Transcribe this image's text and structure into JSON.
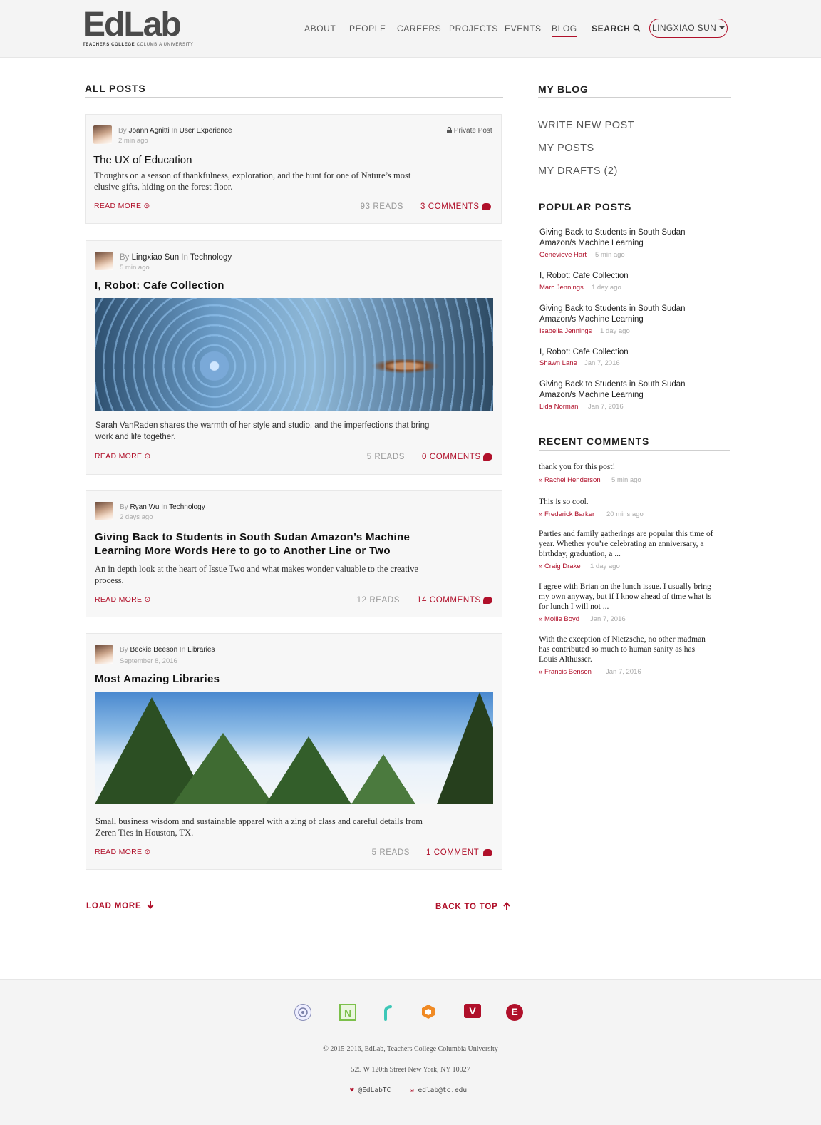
{
  "header": {
    "logo_text": "EdLab",
    "logo_sub_bold": "TEACHERS COLLEGE",
    "logo_sub": "COLUMBIA UNIVERSITY",
    "nav": [
      "ABOUT",
      "PEOPLE",
      "CAREERS",
      "PROJECTS",
      "EVENTS",
      "BLOG"
    ],
    "search_label": "SEARCH",
    "user_label": "LINGXIAO SUN"
  },
  "main": {
    "title": "ALL POSTS",
    "posts": [
      {
        "by": "By",
        "author": "Joann Agnitti",
        "in": "In",
        "category": "User Experience",
        "time": "2 min ago",
        "private": "Private Post",
        "title": "The UX of Education",
        "excerpt": "Thoughts on a season of thankfulness, exploration, and the hunt for one of Nature’s most elusive gifts, hiding on the forest floor.",
        "read_more": "READ MORE",
        "reads": "93 READS",
        "comments": "3 COMMENTS"
      },
      {
        "by": "By",
        "author": "Lingxiao Sun",
        "in": "In",
        "category": "Technology",
        "time": "5 min ago",
        "title": "I, Robot: Cafe Collection",
        "excerpt": "Sarah VanRaden shares the warmth of her style and studio, and the imperfections that bring work and life together.",
        "read_more": "READ MORE",
        "reads": "5 READS",
        "comments": "0 COMMENTS"
      },
      {
        "by": "By",
        "author": "Ryan Wu",
        "in": "In",
        "category": "Technology",
        "time": "2 days ago",
        "title": "Giving Back to Students in South Sudan Amazon’s Machine Learning More Words Here to go to Another Line or Two",
        "excerpt": "An in depth look at the heart of Issue Two and what makes wonder valuable to the creative process.",
        "read_more": "READ MORE",
        "reads": "12 READS",
        "comments": "14 COMMENTS"
      },
      {
        "by": "By",
        "author": "Beckie Beeson",
        "in": "In",
        "category": "Libraries",
        "time": "September 8, 2016",
        "title": "Most Amazing Libraries",
        "excerpt": "Small business wisdom and sustainable apparel with a zing of class and careful details from Zeren Ties in Houston, TX.",
        "read_more": "READ MORE",
        "reads": "5 READS",
        "comments": "1 COMMENT"
      }
    ],
    "load_more": "LOAD MORE",
    "back_to_top": "BACK TO TOP"
  },
  "sidebar": {
    "my_blog_title": "MY BLOG",
    "links": [
      "WRITE NEW POST",
      "MY POSTS",
      "MY DRAFTS (2)"
    ],
    "popular_title": "POPULAR POSTS",
    "popular": [
      {
        "title": "Giving Back to Students in South Sudan Amazon/s Machine Learning",
        "author": "Genevieve Hart",
        "time": "5 min ago"
      },
      {
        "title": "I, Robot: Cafe Collection",
        "author": "Marc Jennings",
        "time": "1 day ago"
      },
      {
        "title": "Giving Back to Students in South Sudan Amazon/s Machine Learning",
        "author": "Isabella Jennings",
        "time": "1 day ago"
      },
      {
        "title": "I, Robot: Cafe Collection",
        "author": "Shawn Lane",
        "time": "Jan 7, 2016"
      },
      {
        "title": "Giving Back to Students in South Sudan Amazon/s Machine Learning",
        "author": "Lida Norman",
        "time": "Jan 7, 2016"
      }
    ],
    "recent_title": "RECENT COMMENTS",
    "recent": [
      {
        "text": "thank you for this post!",
        "author": "Rachel Henderson",
        "time": "5 min ago"
      },
      {
        "text": "This is so cool.",
        "author": "Frederick Barker",
        "time": "20 mins ago"
      },
      {
        "text": "Parties and family gatherings are popular this time of year. Whether you’re celebrating an anniversary, a birthday, graduation, a ...",
        "author": "Craig Drake",
        "time": "1 day ago"
      },
      {
        "text": "I agree with Brian on the lunch issue. I usually bring my own anyway, but if I know ahead of time what is for lunch I will not ...",
        "author": "Mollie Boyd",
        "time": "Jan 7, 2016"
      },
      {
        "text": "With the exception of Nietzsche, no other madman has contributed so much to human sanity as has Louis Althusser.",
        "author": "Francis Benson",
        "time": "Jan 7, 2016"
      }
    ]
  },
  "footer": {
    "icons": [
      "tc-seal-icon",
      "n-logo-icon",
      "y-logo-icon",
      "cube-logo-icon",
      "v-logo-icon",
      "e-logo-icon"
    ],
    "icon_letters": {
      "n": "N",
      "v": "V",
      "e": "E"
    },
    "copyright": "© 2015-2016, EdLab, Teachers College Columbia University",
    "address": "525 W 120th Street New York, NY 10027",
    "twitter": "@EdLabTC",
    "email": "edlab@tc.edu"
  },
  "colors": {
    "accent": "#b0102a",
    "background": "#f4f4f4"
  }
}
